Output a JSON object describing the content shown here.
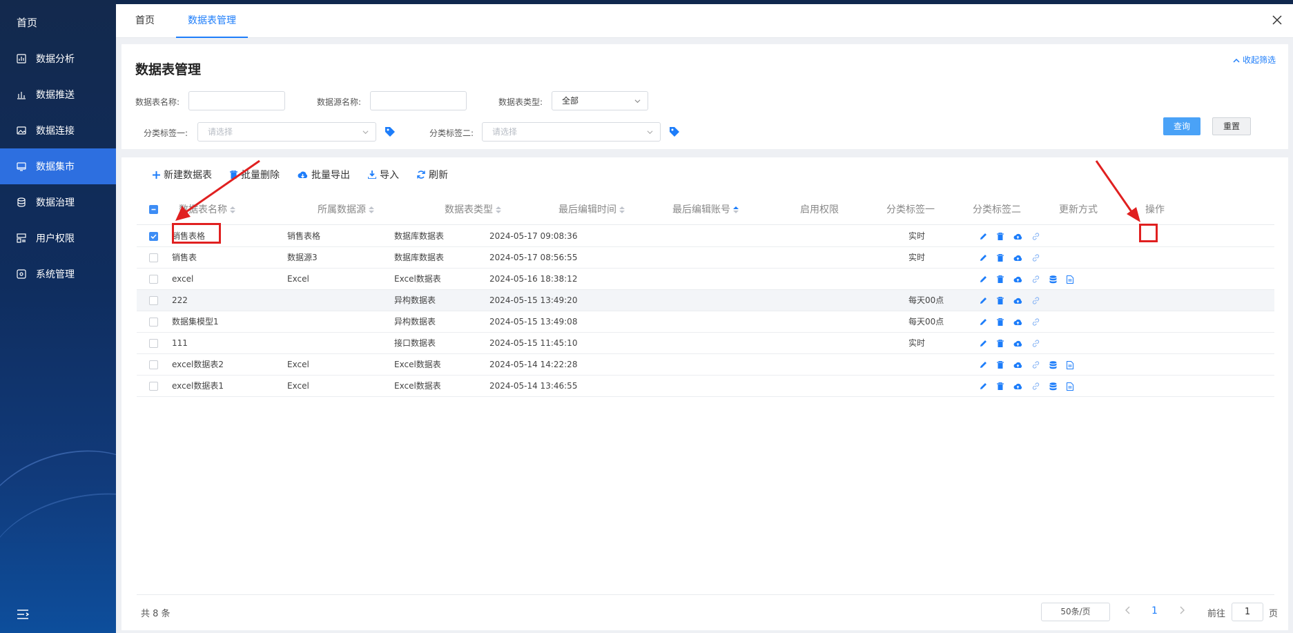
{
  "sidebar": {
    "home": "首页",
    "items": [
      {
        "label": "数据分析",
        "icon": "chart-icon"
      },
      {
        "label": "数据推送",
        "icon": "bar-chart-icon"
      },
      {
        "label": "数据连接",
        "icon": "image-icon"
      },
      {
        "label": "数据集市",
        "icon": "monitor-icon",
        "active": true
      },
      {
        "label": "数据治理",
        "icon": "database-icon"
      },
      {
        "label": "用户权限",
        "icon": "user-layout-icon"
      },
      {
        "label": "系统管理",
        "icon": "settings-icon"
      }
    ]
  },
  "tabs": [
    {
      "label": "首页"
    },
    {
      "label": "数据表管理",
      "active": true
    }
  ],
  "filter": {
    "title": "数据表管理",
    "collapse": "收起筛选",
    "name_label": "数据表名称:",
    "source_label": "数据源名称:",
    "type_label": "数据表类型:",
    "type_value": "全部",
    "tag1_label": "分类标签一:",
    "tag1_placeholder": "请选择",
    "tag2_label": "分类标签二:",
    "tag2_placeholder": "请选择",
    "query": "查询",
    "reset": "重置"
  },
  "toolbar": {
    "new": "新建数据表",
    "batch_delete": "批量删除",
    "batch_export": "批量导出",
    "import": "导入",
    "refresh": "刷新"
  },
  "table": {
    "columns": [
      "数据表名称",
      "所属数据源",
      "数据表类型",
      "最后编辑时间",
      "最后编辑账号",
      "启用权限",
      "分类标签一",
      "分类标签二",
      "更新方式",
      "操作"
    ],
    "rows": [
      {
        "name": "销售表格",
        "source": "销售表格",
        "type": "数据库数据表",
        "time": "2024-05-17 09:08:36",
        "update": "实时",
        "checked": true,
        "extra_ops": false
      },
      {
        "name": "销售表",
        "source": "数据源3",
        "type": "数据库数据表",
        "time": "2024-05-17 08:56:55",
        "update": "实时",
        "checked": false,
        "extra_ops": false
      },
      {
        "name": "excel",
        "source": "Excel",
        "type": "Excel数据表",
        "time": "2024-05-16 18:38:12",
        "update": "",
        "checked": false,
        "extra_ops": true
      },
      {
        "name": "222",
        "source": "",
        "type": "异构数据表",
        "time": "2024-05-15 13:49:20",
        "update": "每天00点",
        "checked": false,
        "extra_ops": false
      },
      {
        "name": "数据集模型1",
        "source": "",
        "type": "异构数据表",
        "time": "2024-05-15 13:49:08",
        "update": "每天00点",
        "checked": false,
        "extra_ops": false
      },
      {
        "name": "111",
        "source": "",
        "type": "接口数据表",
        "time": "2024-05-15 11:45:10",
        "update": "实时",
        "checked": false,
        "extra_ops": false
      },
      {
        "name": "excel数据表2",
        "source": "Excel",
        "type": "Excel数据表",
        "time": "2024-05-14 14:22:28",
        "update": "",
        "checked": false,
        "extra_ops": true
      },
      {
        "name": "excel数据表1",
        "source": "Excel",
        "type": "Excel数据表",
        "time": "2024-05-14 13:46:55",
        "update": "",
        "checked": false,
        "extra_ops": true
      }
    ]
  },
  "pagination": {
    "total": "共 8 条",
    "page_size": "50条/页",
    "current": "1",
    "goto_prefix": "前往",
    "goto_value": "1",
    "goto_suffix": "页"
  },
  "colors": {
    "accent": "#1d7dfa",
    "highlight": "#e02020",
    "sidebar_active": "#2d6fe0"
  }
}
